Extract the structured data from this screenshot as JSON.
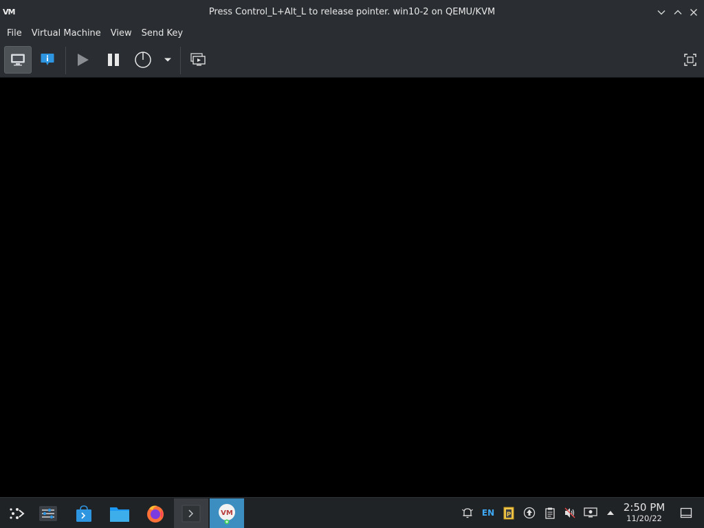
{
  "window": {
    "logo_text": "VM",
    "title": "Press Control_L+Alt_L to release pointer. win10-2 on QEMU/KVM",
    "controls": [
      "minimize-icon",
      "maximize-icon",
      "close-icon"
    ]
  },
  "menu": {
    "items": [
      {
        "label": "File"
      },
      {
        "label": "Virtual Machine"
      },
      {
        "label": "View"
      },
      {
        "label": "Send Key"
      }
    ]
  },
  "toolbar": {
    "buttons": [
      {
        "name": "console-view",
        "icon": "monitor-icon",
        "active": true
      },
      {
        "name": "details-view",
        "icon": "info-icon",
        "active": false
      },
      {
        "name": "run",
        "icon": "play-icon",
        "active": false
      },
      {
        "name": "pause",
        "icon": "pause-icon",
        "active": false
      },
      {
        "name": "shutdown",
        "icon": "power-icon",
        "active": false
      },
      {
        "name": "shutdown-options",
        "icon": "chevron-down-icon",
        "active": false
      },
      {
        "name": "snapshots",
        "icon": "snapshot-icon",
        "active": false
      },
      {
        "name": "fullscreen",
        "icon": "fullscreen-icon",
        "active": false
      }
    ]
  },
  "taskbar": {
    "apps": [
      {
        "name": "application-launcher",
        "icon": "launcher-icon"
      },
      {
        "name": "system-settings",
        "icon": "settings-icon"
      },
      {
        "name": "discover-store",
        "icon": "store-icon"
      },
      {
        "name": "file-manager",
        "icon": "folder-icon"
      },
      {
        "name": "firefox",
        "icon": "firefox-icon"
      },
      {
        "name": "terminal",
        "icon": "terminal-icon"
      },
      {
        "name": "virt-manager",
        "icon": "virt-manager-icon",
        "logo_text": "VM"
      }
    ],
    "tray": {
      "language": "EN",
      "icons": [
        "notifications-icon",
        "clipboard-paste-icon",
        "updates-icon",
        "clipboard-icon",
        "volume-muted-icon",
        "display-icon",
        "tray-expand-icon"
      ]
    },
    "clock": {
      "time": "2:50 PM",
      "date": "11/20/22"
    }
  },
  "colors": {
    "titlebar": "#2a2e32",
    "taskbar": "#202326",
    "accent": "#3d8ec0",
    "tray_accent": "#3fa9f5"
  }
}
